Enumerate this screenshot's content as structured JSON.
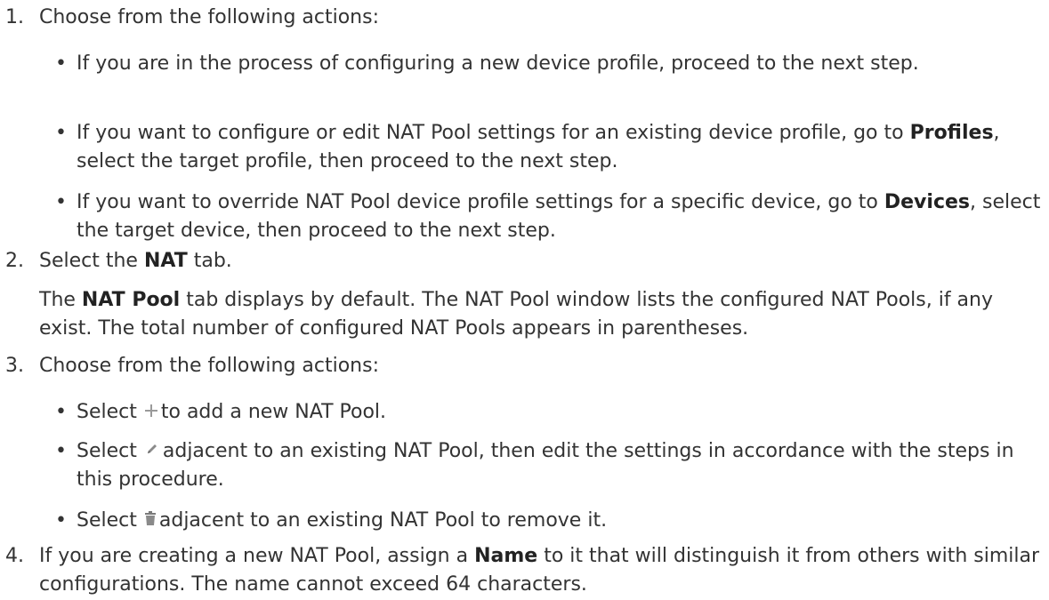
{
  "steps": [
    {
      "num": "1.",
      "text": "Choose from the following actions:",
      "bullets": [
        {
          "text": "If you are in the process of configuring a new device profile, proceed to the next step."
        },
        {
          "before": "If you want to configure or edit NAT Pool settings for an existing device profile, go to ",
          "bold": "Profiles",
          "after": ", select the target profile, then proceed to the next step."
        },
        {
          "before": "If you want to override NAT Pool device profile settings for a specific device, go to ",
          "bold": "Devices",
          "after": ", select the target device, then proceed to the next step."
        }
      ]
    },
    {
      "num": "2.",
      "before": "Select the ",
      "bold": "NAT",
      "after": " tab.",
      "note": {
        "before": "The ",
        "bold": "NAT Pool",
        "after": " tab displays by default. The NAT Pool window lists the configured NAT Pools, if any exist. The total number of configured NAT Pools appears in parentheses."
      }
    },
    {
      "num": "3.",
      "text": "Choose from the following actions:",
      "bullets": [
        {
          "before": "Select",
          "after": "to add a new NAT Pool.",
          "icon": "plus-icon"
        },
        {
          "before": "Select",
          "after": "adjacent to an existing NAT Pool, then edit the settings in accordance with the steps in this procedure.",
          "icon": "pencil-icon"
        },
        {
          "before": "Select",
          "after": "adjacent to an existing NAT Pool to remove it.",
          "icon": "trash-icon"
        }
      ]
    },
    {
      "num": "4.",
      "before": "If you are creating a new NAT Pool, assign a ",
      "bold": "Name",
      "after": " to it that will distinguish it from others with similar configurations. The name cannot exceed 64 characters."
    }
  ],
  "bullet_glyph": "•",
  "colors": {
    "text": "#333333",
    "icon": "#8a8a8a"
  }
}
